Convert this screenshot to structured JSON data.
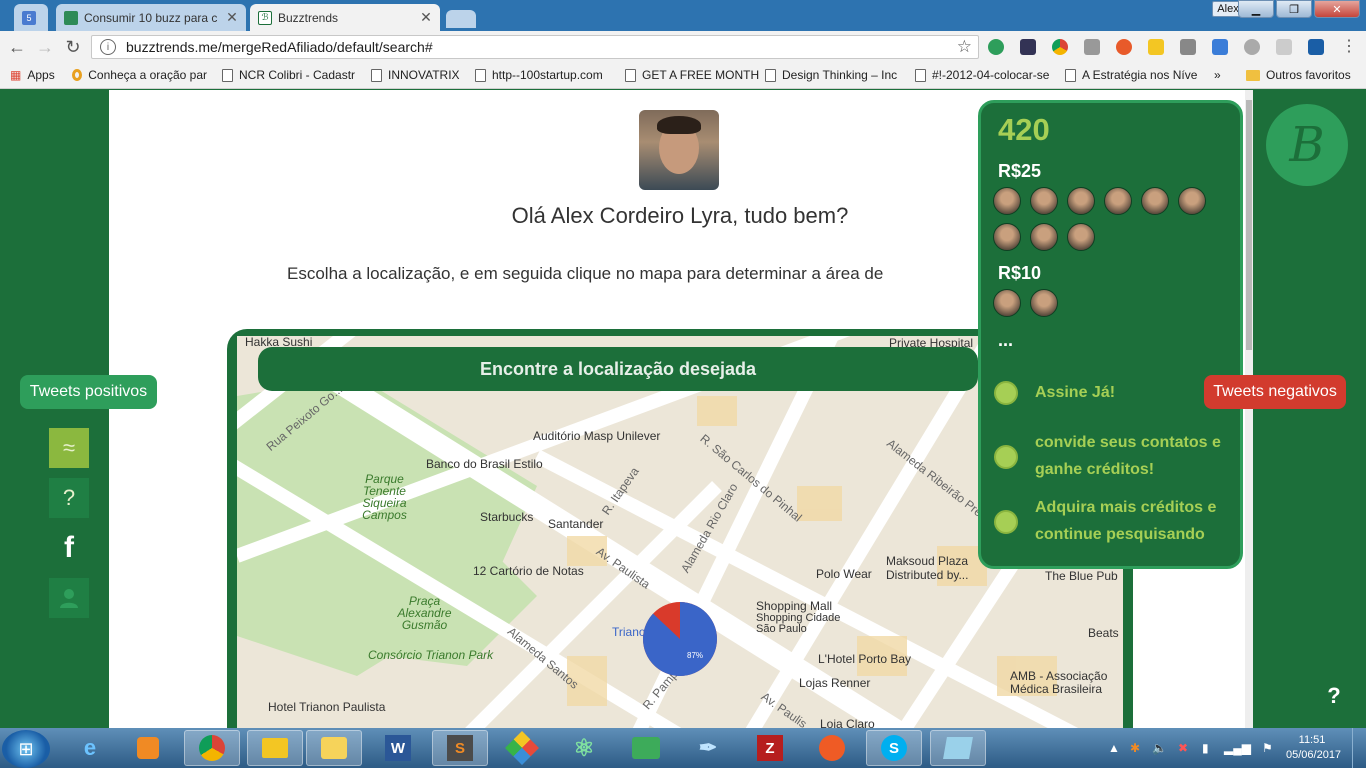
{
  "browser": {
    "tabs": [
      {
        "title": "",
        "favicon": "gmail-count-icon",
        "favicon_text": "5"
      },
      {
        "title": "Consumir 10 buzz para c",
        "favicon": "trello-icon"
      },
      {
        "title": "Buzztrends",
        "favicon": "buzztrends-icon"
      }
    ],
    "user_chip": "Alex",
    "url": "buzztrends.me/mergeRedAfiliado/default/search#",
    "bookmarks": [
      "Apps",
      "Conheça a oração par",
      "NCR Colibri - Cadastr",
      "INNOVATRIX",
      "http--100startup.com",
      "GET A FREE MONTH",
      "Design Thinking – Inc",
      "#!-2012-04-colocar-se",
      "A Estratégia nos Níve",
      "»",
      "Outros favoritos"
    ]
  },
  "page": {
    "greeting": "Olá Alex Cordeiro Lyra, tudo bem?",
    "instruction": "Escolha a localização, e em seguida clique no mapa para determinar a área de",
    "map_banner": "Encontre a localização desejada",
    "tweets_positive": "Tweets positivos",
    "tweets_negative": "Tweets negativos",
    "left_buttons": [
      "≈",
      "?",
      "f",
      "person"
    ],
    "help": "?"
  },
  "panel": {
    "credits": "420",
    "tiers": [
      {
        "label": "R$25",
        "faces": 9
      },
      {
        "label": "R$10",
        "faces": 2
      }
    ],
    "more": "...",
    "options": [
      "Assine Já!",
      "convide seus contatos e ganhe créditos!",
      "Adquira mais créditos e continue pesquisando"
    ],
    "logo_letter": "B"
  },
  "map": {
    "places": [
      "Hakka Sushi",
      "Private Hospital",
      "Auditório Masp Unilever",
      "Banco do Brasil Estilo",
      "Starbucks",
      "Santander",
      "12 Cartório de Notas",
      "Polo Wear",
      "Maksoud Plaza",
      "Distributed by...",
      "The Blue Pub",
      "Shopping Mall",
      "Shopping Cidade",
      "São Paulo",
      "L'Hotel Porto Bay",
      "Lojas Renner",
      "AMB - Associação",
      "Médica Brasileira",
      "Beats",
      "Hotel Trianon Paulista",
      "Loja Claro",
      "Trianon"
    ],
    "parks": [
      "Parque Tenente Siqueira Campos",
      "Praça Alexandre Gusmão",
      "Consórcio Trianon Park"
    ],
    "streets": [
      "Rua Peixoto Go...",
      "Alameda Santos",
      "Av. Paulista",
      "Alameda Rio Claro",
      "R. Itapeva",
      "R. São Carlos do Pinhal",
      "Alameda Ribeirão Pre...",
      "R. Pamp...",
      "Av. Paulis..."
    ],
    "pie": {
      "positive_pct": 87,
      "label": "87%",
      "positive_color": "#3a65c8",
      "negative_color": "#d93a2b"
    }
  },
  "taskbar": {
    "apps": [
      "Internet Explorer",
      "Media Player",
      "Chrome",
      "Explorer",
      "Outlook",
      "Word",
      "Sublime Text",
      "Git",
      "Atom",
      "Gitter",
      "Scribe",
      "FileZilla",
      "Postman",
      "Skype",
      "Notes"
    ],
    "time": "11:51",
    "date": "05/06/2017"
  }
}
